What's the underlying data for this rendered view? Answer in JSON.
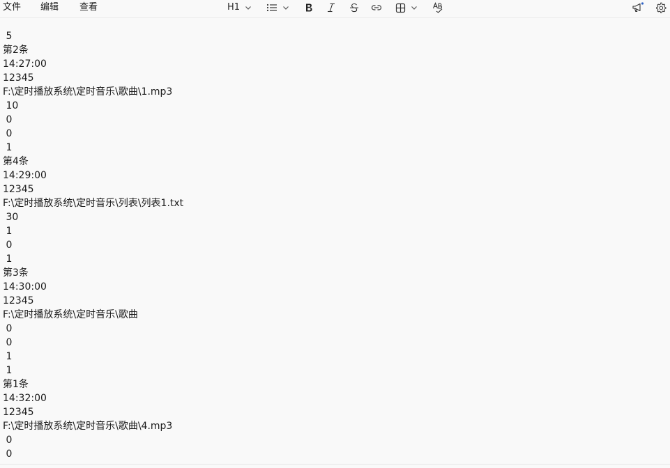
{
  "menu": {
    "file": "文件",
    "edit": "编辑",
    "view": "查看"
  },
  "format_toolbar": {
    "heading": "H1",
    "icons": [
      "chevron-down-icon",
      "list-icon",
      "bold-icon",
      "italic-icon",
      "strikethrough-icon",
      "link-icon",
      "table-icon",
      "spellcheck-icon"
    ]
  },
  "right_icons": [
    "megaphone-icon",
    "gear-icon"
  ],
  "document": {
    "lines": [
      " 5",
      "第2条",
      "14:27:00",
      "12345",
      "F:\\定时播放系统\\定时音乐\\歌曲\\1.mp3",
      " 10",
      " 0",
      " 0",
      " 1",
      "第4条",
      "14:29:00",
      "12345",
      "F:\\定时播放系统\\定时音乐\\列表\\列表1.txt",
      " 30",
      " 1",
      " 0",
      " 1",
      "第3条",
      "14:30:00",
      "12345",
      "F:\\定时播放系统\\定时音乐\\歌曲",
      " 0",
      " 0",
      " 1",
      " 1",
      "第1条",
      "14:32:00",
      "12345",
      "F:\\定时播放系统\\定时音乐\\歌曲\\4.mp3",
      " 0",
      " 0"
    ]
  }
}
